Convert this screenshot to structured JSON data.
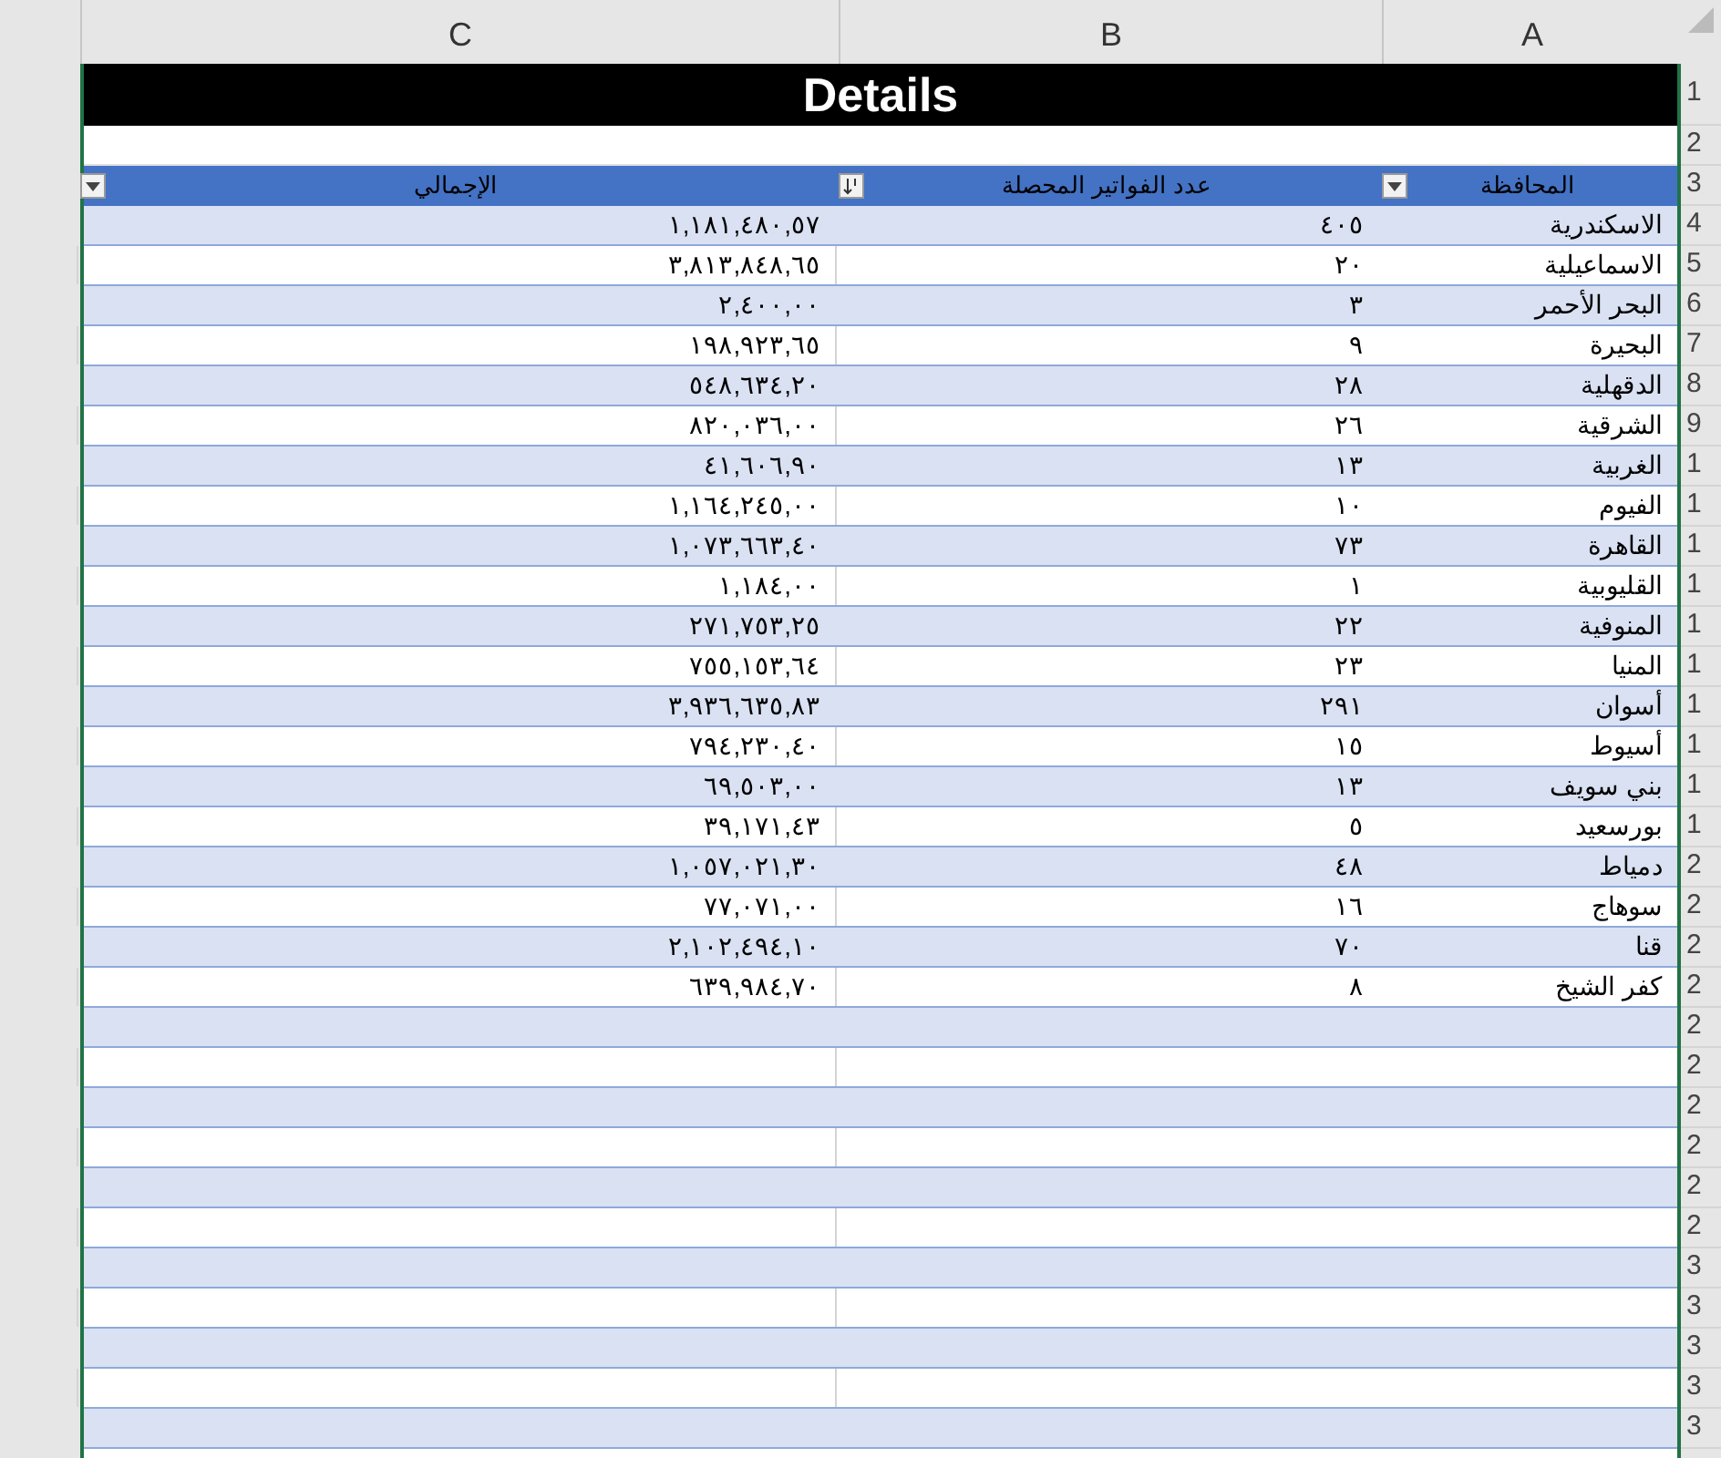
{
  "column_headers": [
    "A",
    "B",
    "C"
  ],
  "title": "Details",
  "row_headers": [
    "1",
    "2",
    "3",
    "4",
    "5",
    "6",
    "7",
    "8",
    "9",
    "1",
    "1",
    "1",
    "1",
    "1",
    "1",
    "1",
    "1",
    "1",
    "1",
    "2",
    "2",
    "2",
    "2",
    "2",
    "2",
    "2",
    "2",
    "2",
    "2",
    "3",
    "3",
    "3",
    "3",
    "3"
  ],
  "table": {
    "columns": [
      {
        "label": "المحافظة",
        "kind": "filter"
      },
      {
        "label": "عدد الفواتير المحصلة",
        "kind": "sorted"
      },
      {
        "label": "الإجمالي",
        "kind": "filter"
      }
    ],
    "rows": [
      [
        "الاسكندرية",
        "٤٠٥",
        "١,١٨١,٤٨٠,٥٧"
      ],
      [
        "الاسماعيلية",
        "٢٠",
        "٣,٨١٣,٨٤٨,٦٥"
      ],
      [
        "البحر الأحمر",
        "٣",
        "٢,٤٠٠,٠٠"
      ],
      [
        "البحيرة",
        "٩",
        "١٩٨,٩٢٣,٦٥"
      ],
      [
        "الدقهلية",
        "٢٨",
        "٥٤٨,٦٣٤,٢٠"
      ],
      [
        "الشرقية",
        "٢٦",
        "٨٢٠,٠٣٦,٠٠"
      ],
      [
        "الغربية",
        "١٣",
        "٤١,٦٠٦,٩٠"
      ],
      [
        "الفيوم",
        "١٠",
        "١,١٦٤,٢٤٥,٠٠"
      ],
      [
        "القاهرة",
        "٧٣",
        "١,٠٧٣,٦٦٣,٤٠"
      ],
      [
        "القليوبية",
        "١",
        "١,١٨٤,٠٠"
      ],
      [
        "المنوفية",
        "٢٢",
        "٢٧١,٧٥٣,٢٥"
      ],
      [
        "المنيا",
        "٢٣",
        "٧٥٥,١٥٣,٦٤"
      ],
      [
        "أسوان",
        "٢٩١",
        "٣,٩٣٦,٦٣٥,٨٣"
      ],
      [
        "أسيوط",
        "١٥",
        "٧٩٤,٢٣٠,٤٠"
      ],
      [
        "بني سويف",
        "١٣",
        "٦٩,٥٠٣,٠٠"
      ],
      [
        "بورسعيد",
        "٥",
        "٣٩,١٧١,٤٣"
      ],
      [
        "دمياط",
        "٤٨",
        "١,٠٥٧,٠٢١,٣٠"
      ],
      [
        "سوهاج",
        "١٦",
        "٧٧,٠٧١,٠٠"
      ],
      [
        "قنا",
        "٧٠",
        "٢,١٠٢,٤٩٤,١٠"
      ],
      [
        "كفر الشيخ",
        "٨",
        "٦٣٩,٩٨٤,٧٠"
      ]
    ]
  }
}
